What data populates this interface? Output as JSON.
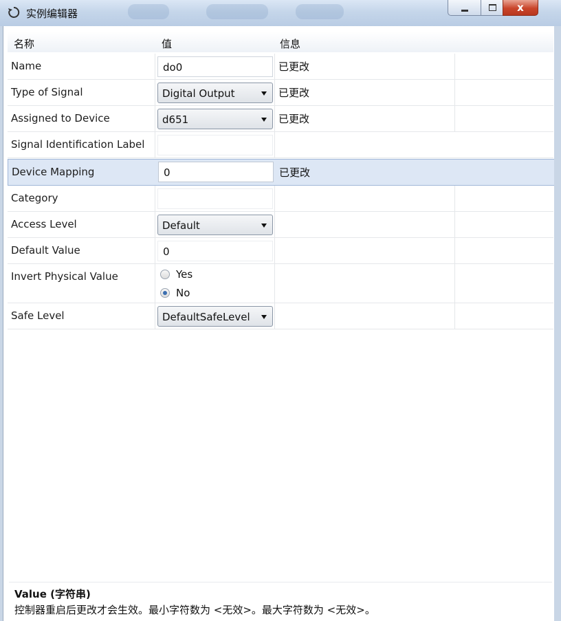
{
  "window": {
    "title": "实例编辑器",
    "close_glyph": "x"
  },
  "columns": {
    "name": "名称",
    "value": "值",
    "info": "信息"
  },
  "rows": [
    {
      "label": "Name",
      "kind": "text",
      "value": "do0",
      "info": "已更改"
    },
    {
      "label": "Type of Signal",
      "kind": "combo",
      "value": "Digital Output",
      "info": "已更改"
    },
    {
      "label": "Assigned to Device",
      "kind": "combo",
      "value": "d651",
      "info": "已更改"
    },
    {
      "label": "Signal Identification Label",
      "kind": "text",
      "value": "",
      "info": ""
    },
    {
      "label": "Device Mapping",
      "kind": "text",
      "value": "0",
      "info": "已更改",
      "selected": true
    },
    {
      "label": "Category",
      "kind": "text",
      "value": "",
      "info": ""
    },
    {
      "label": "Access Level",
      "kind": "combo",
      "value": "Default",
      "info": ""
    },
    {
      "label": "Default Value",
      "kind": "text",
      "value": "0",
      "info": ""
    },
    {
      "label": "Invert Physical Value",
      "kind": "radio",
      "options": [
        "Yes",
        "No"
      ],
      "selected_option": "No",
      "info": ""
    },
    {
      "label": "Safe Level",
      "kind": "combo",
      "value": "DefaultSafeLevel",
      "info": ""
    }
  ],
  "description": {
    "title": "Value (字符串)",
    "text": "控制器重启后更改才会生效。最小字符数为 <无效>。最大字符数为 <无效>。"
  },
  "colors": {
    "selected_row": "#dde7f5",
    "titlebar": "#c5d6ea",
    "close_button": "#c9452b"
  }
}
